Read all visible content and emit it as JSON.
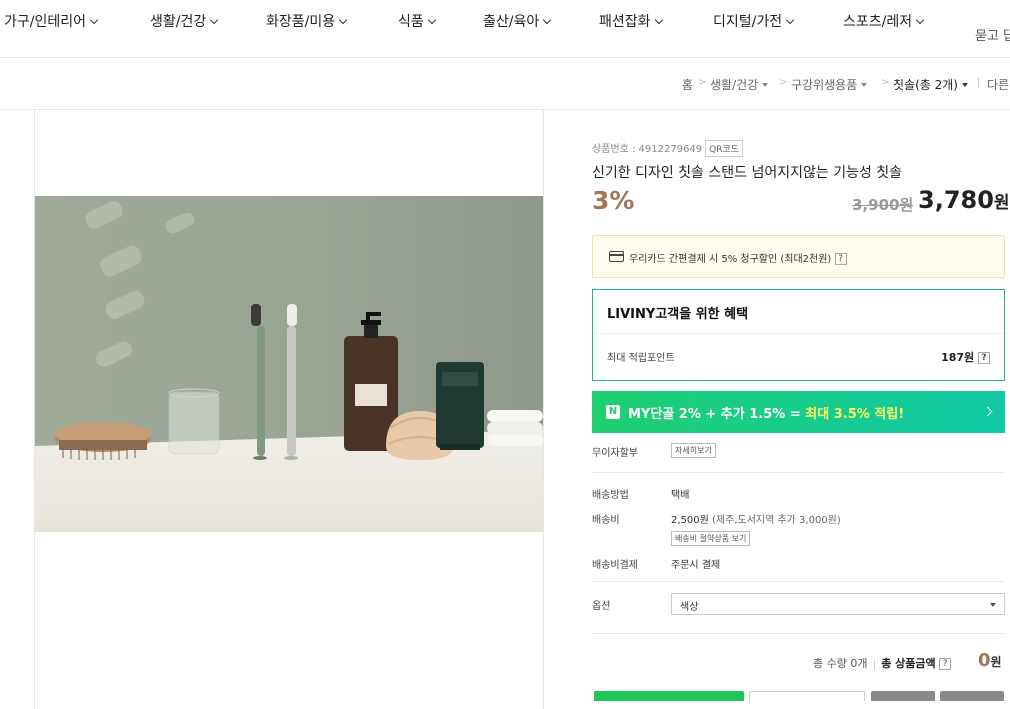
{
  "nav": {
    "items": [
      {
        "label": "가구/인테리어"
      },
      {
        "label": "생활/건강"
      },
      {
        "label": "화장품/미용"
      },
      {
        "label": "식품"
      },
      {
        "label": "출산/육아"
      },
      {
        "label": "패션잡화"
      },
      {
        "label": "디지털/가전"
      },
      {
        "label": "스포츠/레저"
      }
    ],
    "extra": "묻고 답"
  },
  "breadcrumb": {
    "home": "홈",
    "sep": ">",
    "cat1": "생활/건강",
    "cat2": "구강위생용품",
    "cat3": "칫솔(총 2개)",
    "bar": "|",
    "other": "다른"
  },
  "product": {
    "code_label": "상품번호 : 4912279649",
    "qr_label": "QR코드",
    "title": "신기한 디자인 칫솔 스탠드 넘어지지않는 기능성 칫솔",
    "discount_rate": "3%",
    "original_price": "3,900원",
    "price_number": "3,780",
    "price_unit": "원"
  },
  "card_promo": {
    "text": "우리카드 간편결제 시 5% 청구할인 (최대2천원)",
    "help": "?"
  },
  "benefit": {
    "title": "LIVINY고객을 위한 혜택",
    "point_label": "최대 적립포인트",
    "point_value": "187원",
    "help": "?"
  },
  "my_bar": {
    "logo": "N",
    "text_main": "MY단골 2% + 추가 1.5% = ",
    "text_highlight": "최대 3.5% 적립!"
  },
  "details": {
    "installment_label": "무이자할부",
    "installment_button": "자세히보기",
    "shipping_method_label": "배송방법",
    "shipping_method_value": "택배",
    "shipping_fee_label": "배송비",
    "shipping_fee_value": "2,500원",
    "shipping_fee_extra": "(제주,도서지역 추가 3,000원)",
    "shipping_saving_button": "배송비 절약상품 보기",
    "shipping_pay_label": "배송비결제",
    "shipping_pay_value": "주문시 결제"
  },
  "option": {
    "label": "옵션",
    "selected": "색상"
  },
  "total": {
    "qty_text": "총 수량 0개",
    "bar": "|",
    "amount_label": "총 상품금액",
    "help": "?",
    "amount_value": "0",
    "amount_unit": "원"
  }
}
